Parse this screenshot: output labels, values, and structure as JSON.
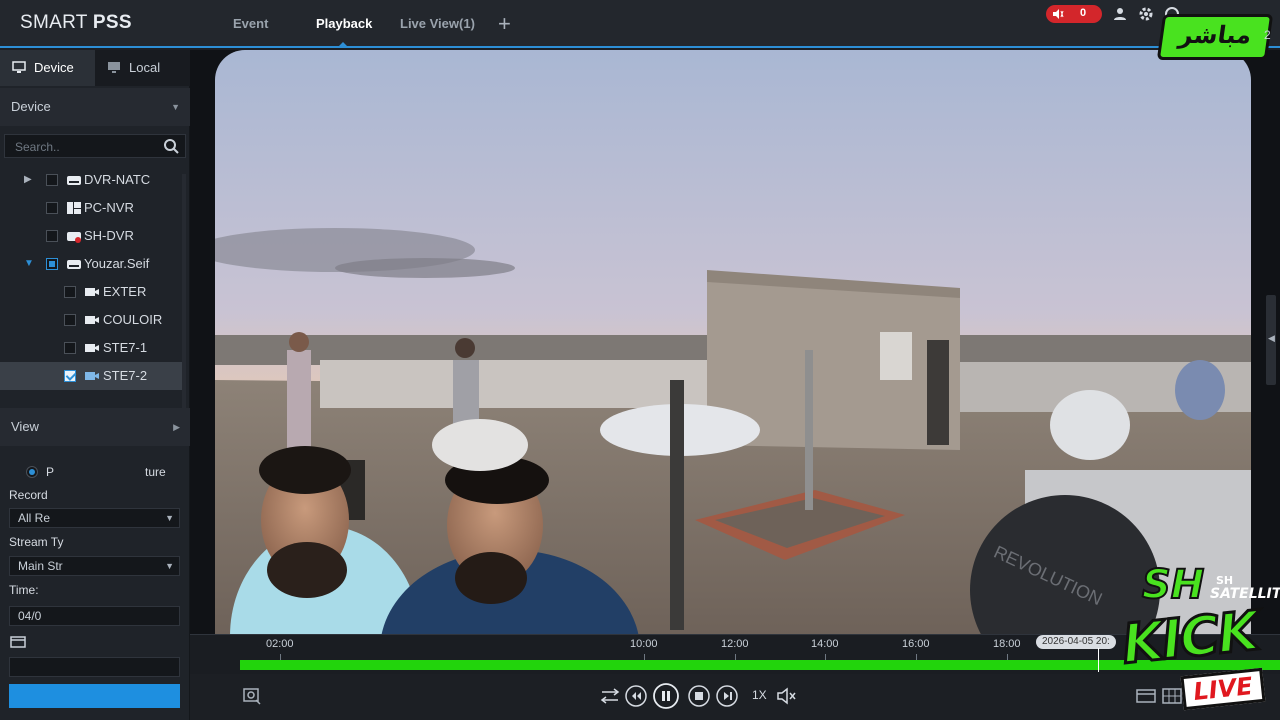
{
  "app": {
    "brand_light": "SMART ",
    "brand_bold": "PSS",
    "tabs": [
      {
        "label": "Event"
      },
      {
        "label": "Playback"
      },
      {
        "label": "Live View(1)"
      }
    ],
    "alarm_count": "0"
  },
  "sidebar": {
    "tabs": [
      {
        "label": "Device"
      },
      {
        "label": "Local"
      }
    ],
    "device_section": "Device",
    "search_placeholder": "Search..",
    "tree": [
      {
        "label": "DVR-NATC"
      },
      {
        "label": "PC-NVR"
      },
      {
        "label": "SH-DVR"
      },
      {
        "label": "Youzar.Seif"
      },
      {
        "label": "EXTER"
      },
      {
        "label": "COULOIR"
      },
      {
        "label": "STE7-1"
      },
      {
        "label": "STE7-2"
      }
    ],
    "view_section": "View",
    "view": {
      "radio_label_partial": "P",
      "radio_label_tail": "ture",
      "record_label": "Record",
      "record_value": "All Re",
      "stream_label": "Stream Ty",
      "stream_value": "Main Str",
      "time_label": "Time:",
      "time_value": "04/0"
    }
  },
  "timeline": {
    "ticks": [
      "02:00",
      "10:00",
      "12:00",
      "14:00",
      "16:00",
      "18:00"
    ],
    "stamp": "2026-04-05 20:",
    "recording_color": "#22d40c"
  },
  "controls": {
    "speed": "1X"
  },
  "overlay": {
    "live_badge": "مباشر",
    "logo_sh": "SH",
    "logo_sh_small": "SH",
    "logo_satellite": "SATELLITE",
    "logo_kick": "KICK",
    "logo_live": "LIVE",
    "watermark_brand": "REVOLUTION",
    "right_edge_text": "2"
  },
  "colors": {
    "accent": "#2d8fd6",
    "alarm": "#d3262b",
    "overlay_green": "#49e21f"
  }
}
